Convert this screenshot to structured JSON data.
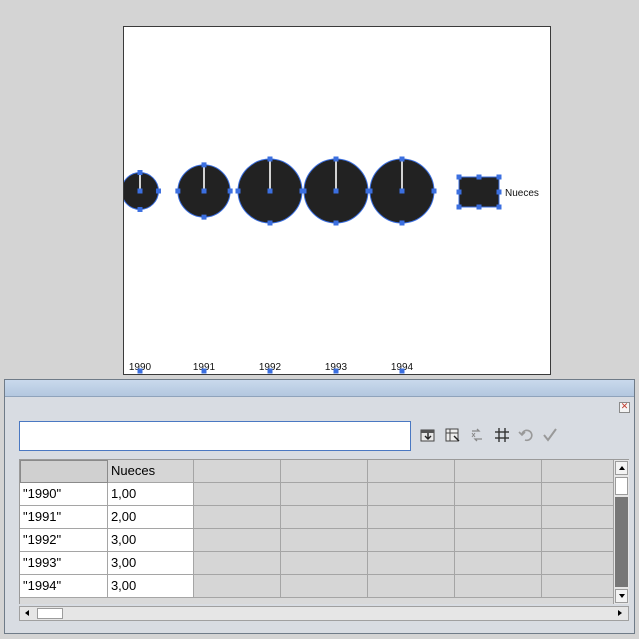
{
  "colors": {
    "accent": "#4a78c2",
    "selection_handle": "#3b6fe0",
    "mark_fill": "#222222"
  },
  "artboard": {
    "legend_label": "Nueces",
    "x_labels": [
      "1990",
      "1991",
      "1992",
      "1993",
      "1994"
    ]
  },
  "chart_data": {
    "type": "scatter",
    "categories": [
      "1990",
      "1991",
      "1992",
      "1993",
      "1994"
    ],
    "series": [
      {
        "name": "Nueces",
        "values": [
          1,
          2,
          3,
          3,
          3
        ]
      }
    ]
  },
  "panel": {
    "close_icon": "close-icon",
    "input_value": "",
    "toolbar": [
      {
        "name": "import-data-icon"
      },
      {
        "name": "transpose-row-column-icon"
      },
      {
        "name": "switch-xy-icon"
      },
      {
        "name": "cell-style-icon"
      },
      {
        "name": "revert-icon"
      },
      {
        "name": "apply-icon"
      }
    ],
    "grid": {
      "header": [
        "",
        "Nueces"
      ],
      "rows": [
        [
          "\"1990\"",
          "1,00"
        ],
        [
          "\"1991\"",
          "2,00"
        ],
        [
          "\"1992\"",
          "3,00"
        ],
        [
          "\"1993\"",
          "3,00"
        ],
        [
          "\"1994\"",
          "3,00"
        ]
      ]
    }
  }
}
